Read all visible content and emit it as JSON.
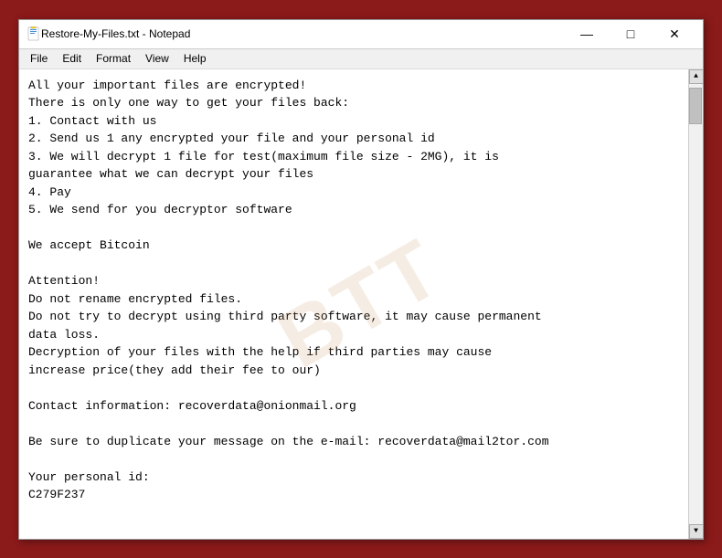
{
  "window": {
    "title": "Restore-My-Files.txt - Notepad",
    "icon": "notepad-icon"
  },
  "title_controls": {
    "minimize": "—",
    "maximize": "□",
    "close": "✕"
  },
  "menu": {
    "items": [
      "File",
      "Edit",
      "Format",
      "View",
      "Help"
    ]
  },
  "content": {
    "text": "All your important files are encrypted!\nThere is only one way to get your files back:\n1. Contact with us\n2. Send us 1 any encrypted your file and your personal id\n3. We will decrypt 1 file for test(maximum file size - 2MG), it is\nguarantee what we can decrypt your files\n4. Pay\n5. We send for you decryptor software\n\nWe accept Bitcoin\n\nAttention!\nDo not rename encrypted files.\nDo not try to decrypt using third party software, it may cause permanent\ndata loss.\nDecryption of your files with the help if third parties may cause\nincrease price(they add their fee to our)\n\nContact information: recoverdata@onionmail.org\n\nBe sure to duplicate your message on the e-mail: recoverdata@mail2tor.com\n\nYour personal id:\nC279F237"
  },
  "watermark": {
    "text": "BTT"
  }
}
